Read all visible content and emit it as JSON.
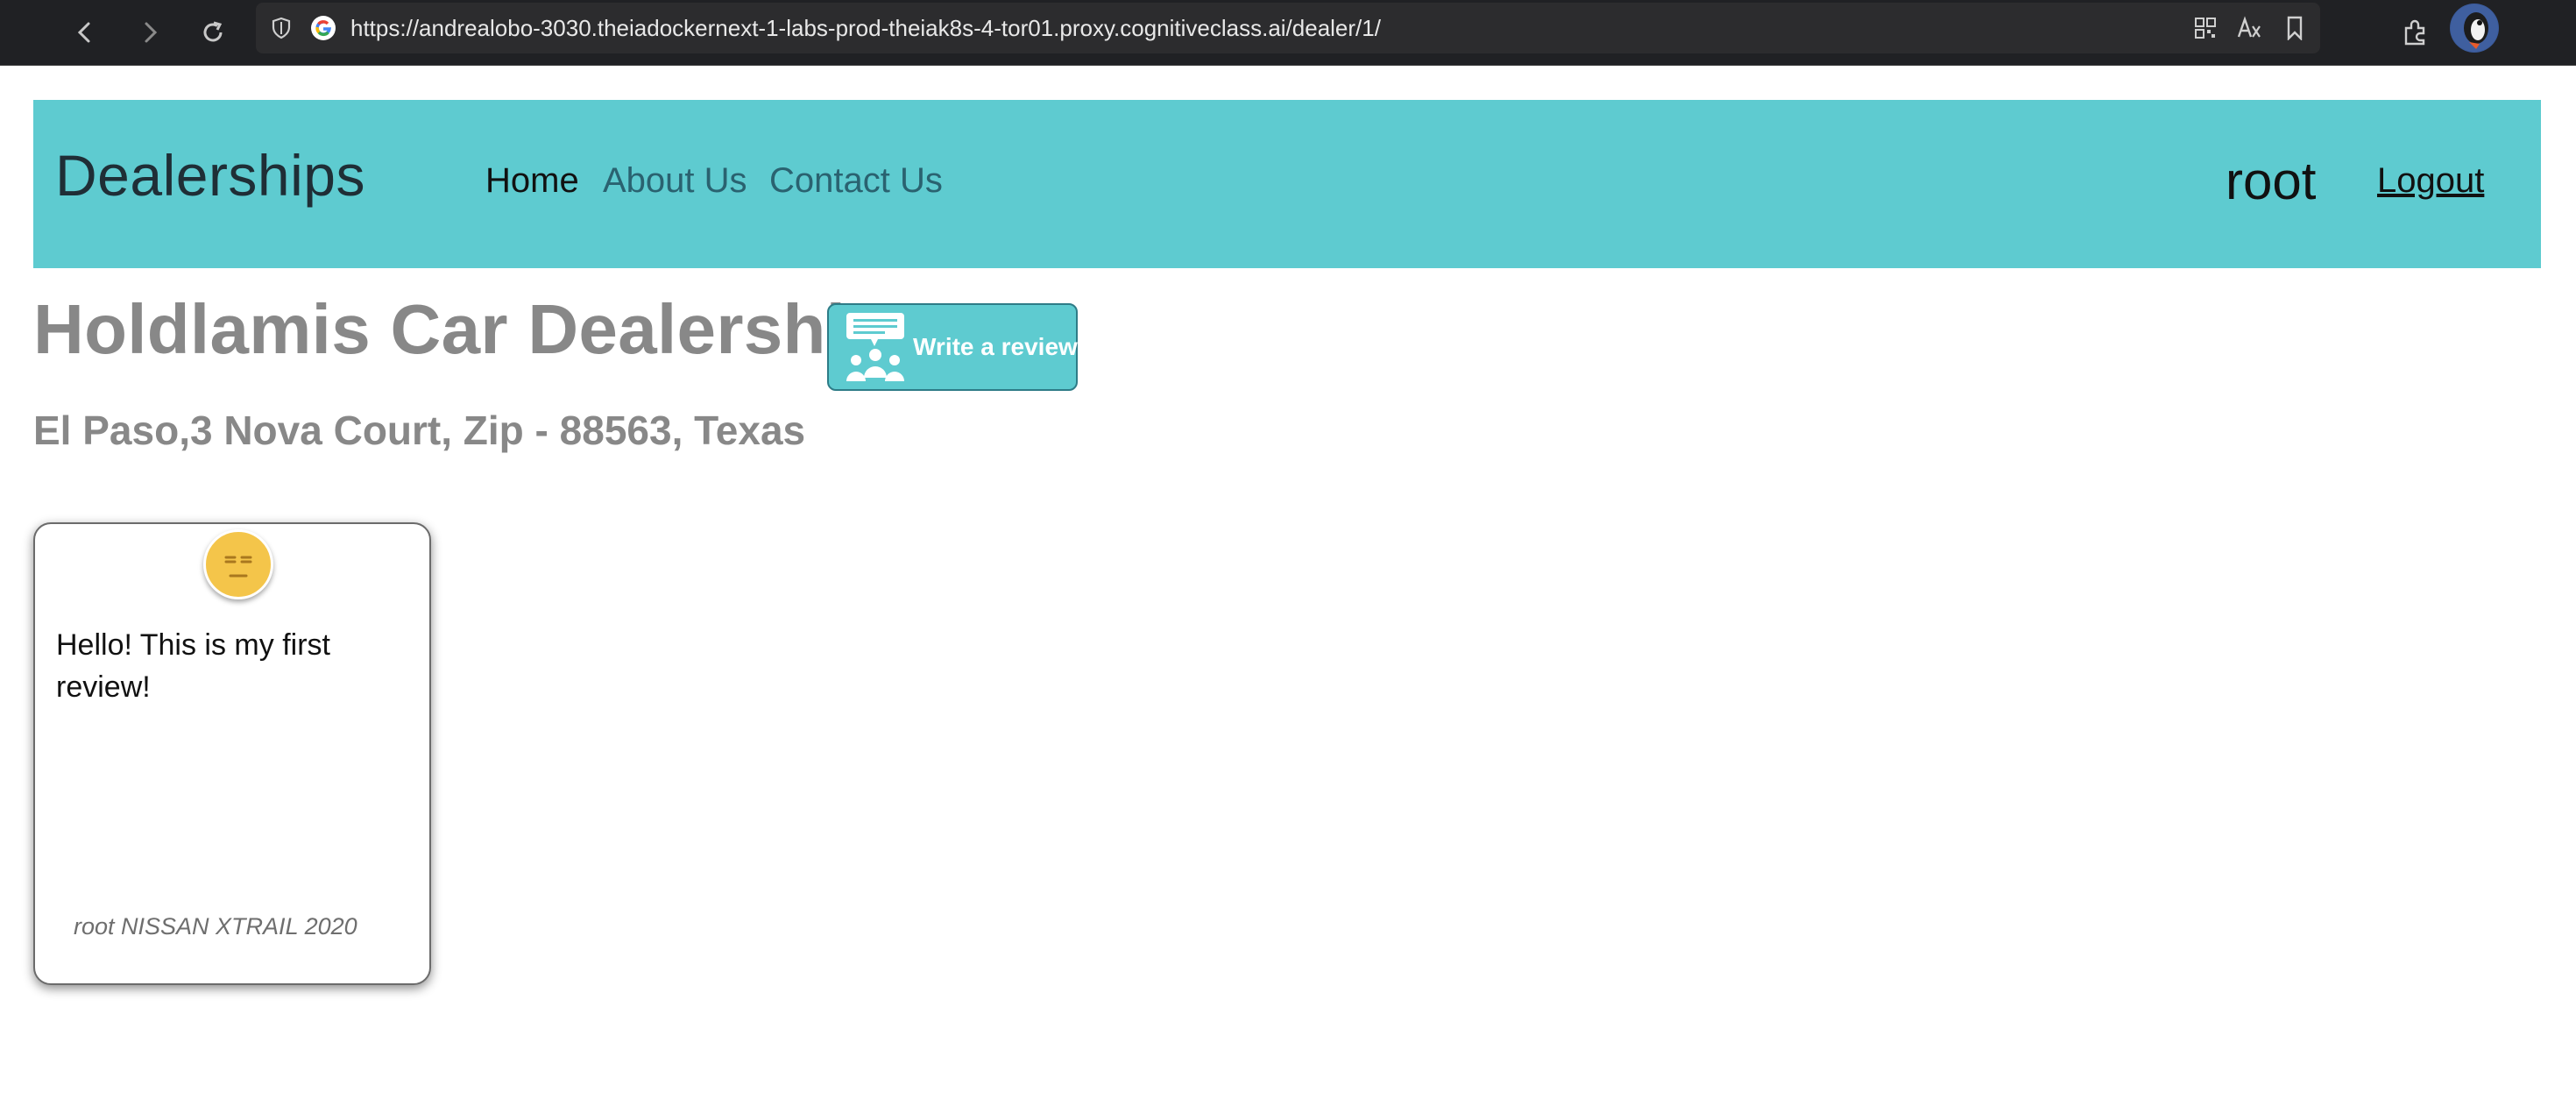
{
  "browser": {
    "url": "https://andrealobo-3030.theiadockernext-1-labs-prod-theiak8s-4-tor01.proxy.cognitiveclass.ai/dealer/1/",
    "icons": [
      "back-icon",
      "forward-icon",
      "reload-icon",
      "shield-icon",
      "google-icon",
      "qr-code-icon",
      "translate-icon",
      "bookmark-icon",
      "extensions-icon",
      "profile-avatar"
    ]
  },
  "navbar": {
    "brand": "Dealerships",
    "links": [
      "Home",
      "About Us",
      "Contact Us"
    ],
    "active_link": "Home",
    "username": "root",
    "logout": "Logout",
    "background_color": "#5ecbd0"
  },
  "dealer": {
    "name": "Holdlamis Car Dealership",
    "address": "El Paso,3 Nova Court, Zip - 88563, Texas",
    "write_review_label": "Write a review"
  },
  "reviews": [
    {
      "sentiment_icon": "neutral-face-icon",
      "text": "Hello! This is my first review!",
      "meta": "root NISSAN XTRAIL 2020"
    }
  ]
}
